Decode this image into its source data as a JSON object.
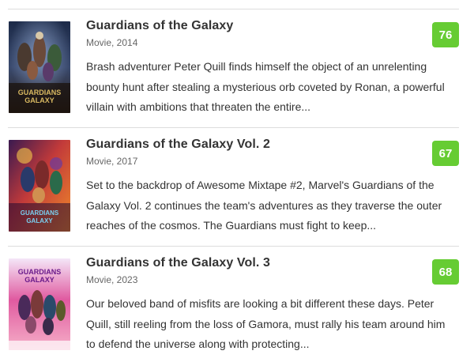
{
  "results": [
    {
      "title": "Guardians of the Galaxy",
      "meta": "Movie, 2014",
      "description": "Brash adventurer Peter Quill finds himself the object of an unrelenting bounty hunt after stealing a mysterious orb coveted by Ronan, a powerful villain with ambitions that threaten the entire...",
      "score": "76",
      "score_color": "#66cc33",
      "poster_title": "GUARDIANS GALAXY"
    },
    {
      "title": "Guardians of the Galaxy Vol. 2",
      "meta": "Movie, 2017",
      "description": "Set to the backdrop of Awesome Mixtape #2, Marvel's Guardians of the Galaxy Vol. 2 continues the team's adventures as they traverse the outer reaches of the cosmos. The Guardians must fight to keep...",
      "score": "67",
      "score_color": "#66cc33",
      "poster_title": "GUARDIANS GALAXY"
    },
    {
      "title": "Guardians of the Galaxy Vol. 3",
      "meta": "Movie, 2023",
      "description": "Our beloved band of misfits are looking a bit different these days. Peter Quill, still reeling from the loss of Gamora, must rally his team around him to defend the universe along with protecting...",
      "score": "68",
      "score_color": "#66cc33",
      "poster_title": "GUARDIANS GALAXY"
    }
  ]
}
